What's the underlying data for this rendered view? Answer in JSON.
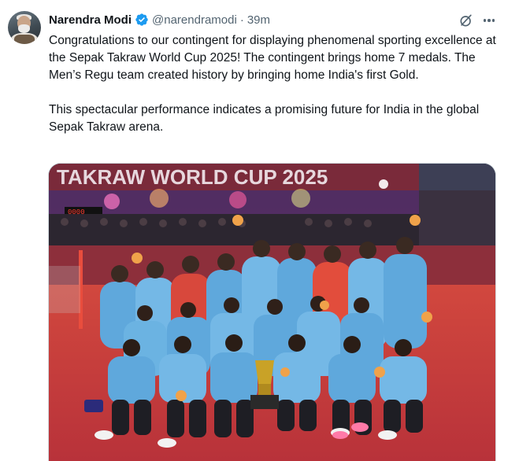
{
  "post": {
    "author_name": "Narendra Modi",
    "handle": "@narendramodi",
    "separator": "·",
    "timestamp": "39m",
    "paragraphs": [
      "Congratulations to our contingent for displaying phenomenal sporting excellence at the Sepak Takraw World Cup 2025! The contingent brings home 7 medals. The Men’s Regu team created history by bringing home India's first Gold.",
      "This spectacular performance indicates a promising future for India in the global Sepak Takraw arena."
    ],
    "photo_banner_text": "TAKRAW WORLD CUP 2025",
    "scoreboard_text": "0000"
  },
  "icons": {
    "verified": "verified-badge-icon",
    "grok": "grok-icon",
    "more": "more-options-icon"
  },
  "colors": {
    "verified_blue": "#1d9bf0",
    "secondary_text": "#536471",
    "court_red": "#c8323a",
    "jersey_blue": "#5fa8dc"
  }
}
